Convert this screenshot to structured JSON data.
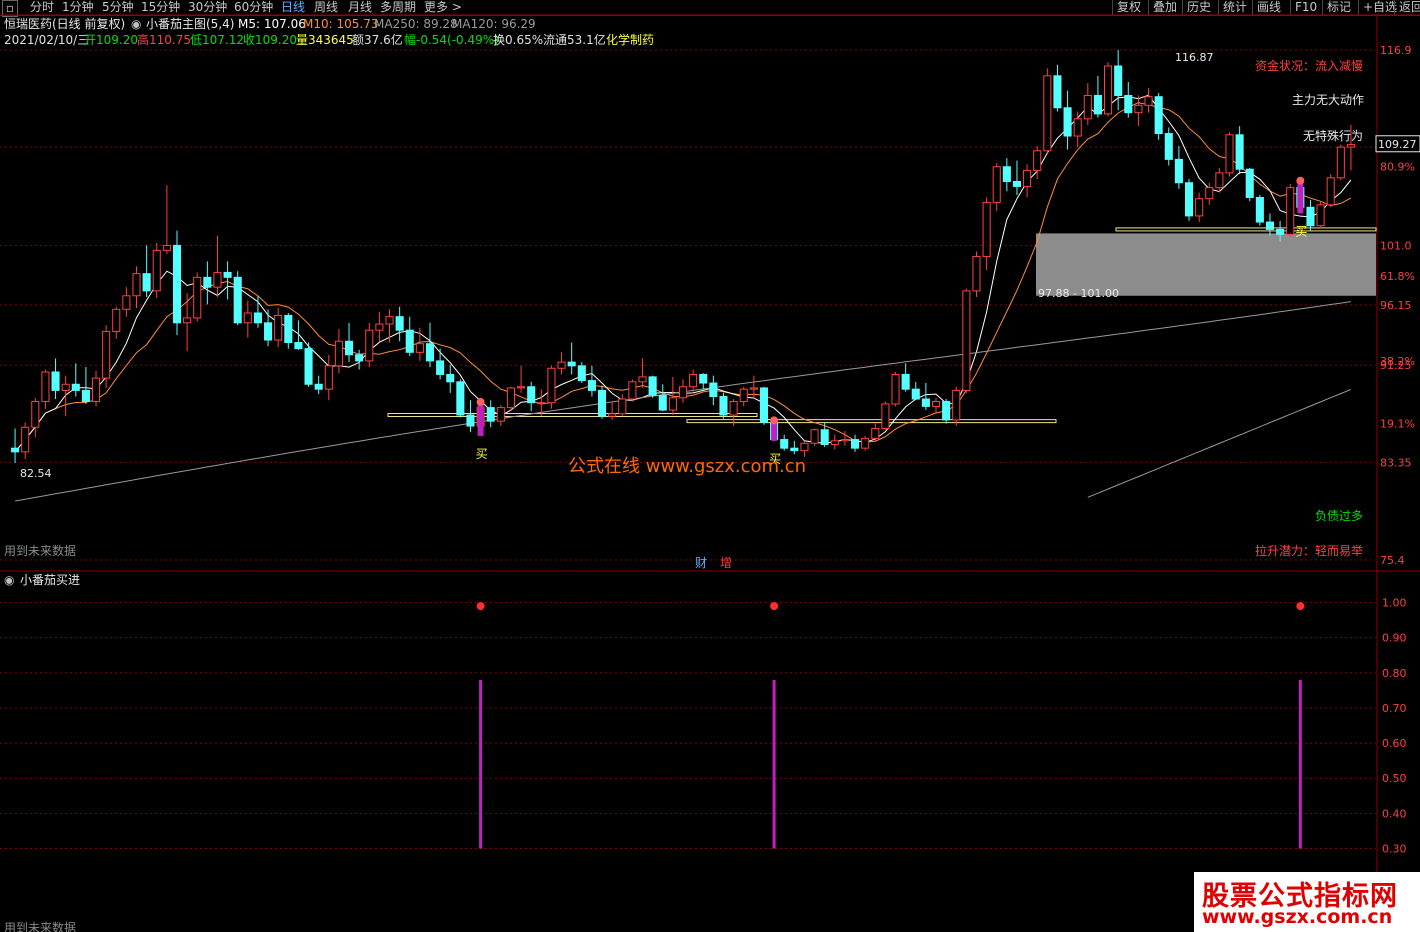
{
  "toolbar": {
    "left_items": [
      "分时",
      "1分钟",
      "5分钟",
      "15分钟",
      "30分钟",
      "60分钟",
      "日线",
      "周线",
      "月线",
      "多周期",
      "更多 >"
    ],
    "active": "日线",
    "right_items": [
      "复权",
      "叠加",
      "历史",
      "统计",
      "画线",
      "F10",
      "标记",
      "+自选",
      "返回"
    ]
  },
  "header": {
    "stock": "恒瑞医药(日线 前复权)",
    "indicator": "小番茄主图(5,4)",
    "m5": "M5: 107.06",
    "m10": "M10: 105.73",
    "ma250": "MA250: 89.28",
    "ma120": "MA120: 96.29",
    "date": "2021/02/10/三",
    "open": "开109.20",
    "high": "高110.75",
    "low": "低107.12",
    "close": "收109.20",
    "vol": "量343645",
    "amount": "额37.6亿",
    "change": "幅-0.54(-0.49%)",
    "turnover": "换0.65%",
    "float": "流通53.1亿",
    "sector": "化学制药"
  },
  "annotations": {
    "capital": "资金状况：流入减慢",
    "main_force": "主力无大动作",
    "behavior": "无特殊行为",
    "debt": "负债过多",
    "potential": "拉升潜力：轻而易举",
    "future": "用到未来数据",
    "future2": "用到未来数据",
    "high_label": "116.87",
    "low_label": "82.54",
    "zone_label": "97.88 - 101.00",
    "buy": "买",
    "watermark": "公式在线  www.gszx.com.cn",
    "cai": "财",
    "zeng": "增",
    "price_tag": "109.27"
  },
  "sub_panel": {
    "title": "小番茄买进"
  },
  "colors": {
    "bg": "#000000",
    "up": "#ff4040",
    "down": "#54ffff",
    "ma_white": "#ffffff",
    "ma_orange": "#ff8c3c",
    "ma_gray": "#9a9a9a",
    "signal": "#c020c0",
    "support": "#f0e68c",
    "grid": "#8b0000"
  },
  "logo": {
    "line1": "股票公式指标网",
    "line2": "www.gszx.com.cn"
  },
  "chart_data": [
    {
      "type": "candlestick",
      "title": "小番茄主图(5,4)",
      "y_axis_labels": [
        "116.9",
        "109.0",
        "101.0",
        "96.15",
        "91.25",
        "83.35",
        "75.4"
      ],
      "pct_labels": [
        "80.9%",
        "61.8%",
        "38.2%",
        "19.1%"
      ],
      "ylim": [
        75.4,
        116.9
      ],
      "candles": [
        [
          84.5,
          86.1,
          83.3,
          84.2
        ],
        [
          84.2,
          86.6,
          83.6,
          86.2
        ],
        [
          86.2,
          88.6,
          85.4,
          88.3
        ],
        [
          88.3,
          90.9,
          87.7,
          90.7
        ],
        [
          90.7,
          91.8,
          88.5,
          89.2
        ],
        [
          89.2,
          90.4,
          87.1,
          89.7
        ],
        [
          89.7,
          91.4,
          88.7,
          89.2
        ],
        [
          89.2,
          91.1,
          88.1,
          88.3
        ],
        [
          88.3,
          90.8,
          87.9,
          90.2
        ],
        [
          90.2,
          94.5,
          89.4,
          94.0
        ],
        [
          94.0,
          96.0,
          93.4,
          95.8
        ],
        [
          95.8,
          97.6,
          95.2,
          96.9
        ],
        [
          96.9,
          99.3,
          95.9,
          98.7
        ],
        [
          98.7,
          101.0,
          96.8,
          97.3
        ],
        [
          97.3,
          101.2,
          96.7,
          100.6
        ],
        [
          100.6,
          105.9,
          100.3,
          101.0
        ],
        [
          101.0,
          102.2,
          93.7,
          94.7
        ],
        [
          94.7,
          97.1,
          92.4,
          95.1
        ],
        [
          95.1,
          98.8,
          94.8,
          98.4
        ],
        [
          98.4,
          99.7,
          96.2,
          97.6
        ],
        [
          97.6,
          101.8,
          96.8,
          98.8
        ],
        [
          98.8,
          99.7,
          96.6,
          98.4
        ],
        [
          98.4,
          98.9,
          94.5,
          94.7
        ],
        [
          94.7,
          96.5,
          93.5,
          95.5
        ],
        [
          95.5,
          96.9,
          94.3,
          94.7
        ],
        [
          94.7,
          95.8,
          92.8,
          93.3
        ],
        [
          93.3,
          95.9,
          92.7,
          95.3
        ],
        [
          95.3,
          95.5,
          92.6,
          93.1
        ],
        [
          93.1,
          94.9,
          92.5,
          92.6
        ],
        [
          92.6,
          93.1,
          89.5,
          89.7
        ],
        [
          89.7,
          90.4,
          88.9,
          89.3
        ],
        [
          89.3,
          92.1,
          88.4,
          91.2
        ],
        [
          91.2,
          94.2,
          90.6,
          93.2
        ],
        [
          93.2,
          94.7,
          91.5,
          92.1
        ],
        [
          92.1,
          92.5,
          90.9,
          91.6
        ],
        [
          91.6,
          94.7,
          91.1,
          94.1
        ],
        [
          94.1,
          95.6,
          93.2,
          94.6
        ],
        [
          94.6,
          95.8,
          93.1,
          95.2
        ],
        [
          95.2,
          96.0,
          93.2,
          94.1
        ],
        [
          94.1,
          95.2,
          92.0,
          92.3
        ],
        [
          92.3,
          94.3,
          91.6,
          93.0
        ],
        [
          93.0,
          94.7,
          91.1,
          91.6
        ],
        [
          91.6,
          92.6,
          90.1,
          90.5
        ],
        [
          90.5,
          91.3,
          89.0,
          89.9
        ],
        [
          89.9,
          90.1,
          87.0,
          87.2
        ],
        [
          87.2,
          88.4,
          85.8,
          86.3
        ],
        [
          86.3,
          88.1,
          85.5,
          87.8
        ],
        [
          87.8,
          88.4,
          86.2,
          86.7
        ],
        [
          86.7,
          88.0,
          86.3,
          87.8
        ],
        [
          87.8,
          89.5,
          87.6,
          89.4
        ],
        [
          89.4,
          91.2,
          89.0,
          89.5
        ],
        [
          89.5,
          89.9,
          87.5,
          88.2
        ],
        [
          88.2,
          89.3,
          87.1,
          88.2
        ],
        [
          88.2,
          91.2,
          87.7,
          91.0
        ],
        [
          91.0,
          92.3,
          90.5,
          91.5
        ],
        [
          91.5,
          93.1,
          90.5,
          91.2
        ],
        [
          91.2,
          91.5,
          89.8,
          90.0
        ],
        [
          90.0,
          91.2,
          88.7,
          89.2
        ],
        [
          89.2,
          89.6,
          86.9,
          87.1
        ],
        [
          87.1,
          88.3,
          86.8,
          87.3
        ],
        [
          87.3,
          88.9,
          87.1,
          88.5
        ],
        [
          88.5,
          90.1,
          88.3,
          89.9
        ],
        [
          89.9,
          91.8,
          89.4,
          90.3
        ],
        [
          90.3,
          90.4,
          88.6,
          88.8
        ],
        [
          88.8,
          89.7,
          87.5,
          87.6
        ],
        [
          87.6,
          90.3,
          87.2,
          88.6
        ],
        [
          88.6,
          90.1,
          88.2,
          89.5
        ],
        [
          89.5,
          90.9,
          89.1,
          90.5
        ],
        [
          90.5,
          90.6,
          89.3,
          89.8
        ],
        [
          89.8,
          90.4,
          88.0,
          88.7
        ],
        [
          88.7,
          89.0,
          86.9,
          87.2
        ],
        [
          87.2,
          88.5,
          86.3,
          88.3
        ],
        [
          88.3,
          89.5,
          87.9,
          89.3
        ],
        [
          89.3,
          90.4,
          88.5,
          89.4
        ],
        [
          89.4,
          89.5,
          86.4,
          86.6
        ],
        [
          86.6,
          86.6,
          85.1,
          85.2
        ],
        [
          85.2,
          85.6,
          84.3,
          84.5
        ],
        [
          84.5,
          85.1,
          84.0,
          84.3
        ],
        [
          84.3,
          85.1,
          83.8,
          84.9
        ],
        [
          84.9,
          86.1,
          84.7,
          86.0
        ],
        [
          86.0,
          86.6,
          84.6,
          84.8
        ],
        [
          84.8,
          85.6,
          84.4,
          85.1
        ],
        [
          85.1,
          85.9,
          84.7,
          85.2
        ],
        [
          85.2,
          85.6,
          84.2,
          84.5
        ],
        [
          84.5,
          85.5,
          84.3,
          85.3
        ],
        [
          85.3,
          86.5,
          85.1,
          86.1
        ],
        [
          86.1,
          88.3,
          86.0,
          88.1
        ],
        [
          88.1,
          90.7,
          87.9,
          90.5
        ],
        [
          90.5,
          91.4,
          89.1,
          89.3
        ],
        [
          89.3,
          89.9,
          88.4,
          88.5
        ],
        [
          88.5,
          89.8,
          87.6,
          87.9
        ],
        [
          87.9,
          88.6,
          87.3,
          88.3
        ],
        [
          88.3,
          88.5,
          86.5,
          86.8
        ],
        [
          86.8,
          89.5,
          86.3,
          89.2
        ],
        [
          89.2,
          97.5,
          89.0,
          97.3
        ],
        [
          97.3,
          100.5,
          96.8,
          100.1
        ],
        [
          100.1,
          104.9,
          99.0,
          104.5
        ],
        [
          104.5,
          107.7,
          103.8,
          107.4
        ],
        [
          107.4,
          108.1,
          105.4,
          106.2
        ],
        [
          106.2,
          107.9,
          105.1,
          105.8
        ],
        [
          105.8,
          107.6,
          104.9,
          107.1
        ],
        [
          107.1,
          109.1,
          106.4,
          108.7
        ],
        [
          108.7,
          115.4,
          108.5,
          114.8
        ],
        [
          114.8,
          115.7,
          111.9,
          112.2
        ],
        [
          112.2,
          113.6,
          108.8,
          109.9
        ],
        [
          109.9,
          111.9,
          109.0,
          111.3
        ],
        [
          111.3,
          114.2,
          110.8,
          113.2
        ],
        [
          113.2,
          114.8,
          111.4,
          111.7
        ],
        [
          111.7,
          115.9,
          111.5,
          115.6
        ],
        [
          115.6,
          116.9,
          112.0,
          113.2
        ],
        [
          113.2,
          114.3,
          111.4,
          111.8
        ],
        [
          111.8,
          113.2,
          110.7,
          112.4
        ],
        [
          112.4,
          113.8,
          111.8,
          113.1
        ],
        [
          113.1,
          113.4,
          109.6,
          110.1
        ],
        [
          110.1,
          110.6,
          107.5,
          108.0
        ],
        [
          108.0,
          109.1,
          105.6,
          106.1
        ],
        [
          106.1,
          106.4,
          103.0,
          103.4
        ],
        [
          103.4,
          105.3,
          102.9,
          104.8
        ],
        [
          104.8,
          106.1,
          104.3,
          105.7
        ],
        [
          105.7,
          107.3,
          105.3,
          106.9
        ],
        [
          106.9,
          110.2,
          106.6,
          110.0
        ],
        [
          110.0,
          110.7,
          106.8,
          107.2
        ],
        [
          107.2,
          107.3,
          104.6,
          104.9
        ],
        [
          104.9,
          105.1,
          102.6,
          102.9
        ],
        [
          102.9,
          103.6,
          101.8,
          102.3
        ],
        [
          102.3,
          103.0,
          101.3,
          101.9
        ],
        [
          101.9,
          106.0,
          101.7,
          105.7
        ],
        [
          105.7,
          106.1,
          103.6,
          104.1
        ],
        [
          104.1,
          104.7,
          102.2,
          102.6
        ],
        [
          102.6,
          104.6,
          102.4,
          104.3
        ],
        [
          104.3,
          106.8,
          104.1,
          106.5
        ],
        [
          106.5,
          109.2,
          106.3,
          109.0
        ],
        [
          109.0,
          110.8,
          107.1,
          109.2
        ]
      ],
      "support_lines": [
        {
          "y": 87.3,
          "from": 0,
          "to": 13
        },
        {
          "y": 86.7,
          "from": 0,
          "to": 12
        },
        {
          "y": 101.5,
          "from": 0,
          "to": 9
        }
      ],
      "zone": [
        97.88,
        101.0
      ],
      "buy_signals": [
        {
          "index": 46,
          "label": "买"
        },
        {
          "index": 75,
          "label": "买"
        },
        {
          "index": 127,
          "label": "买"
        }
      ]
    },
    {
      "type": "bar",
      "title": "小番茄买进",
      "y_axis_labels": [
        "1.00",
        "0.90",
        "0.80",
        "0.70",
        "0.60",
        "0.50",
        "0.40",
        "0.30"
      ],
      "ylim": [
        0.25,
        1.05
      ],
      "signals": [
        {
          "index": 46,
          "value": 0.78,
          "base": 0.3
        },
        {
          "index": 75,
          "value": 0.78,
          "base": 0.3
        },
        {
          "index": 127,
          "value": 0.78,
          "base": 0.3
        }
      ]
    }
  ]
}
